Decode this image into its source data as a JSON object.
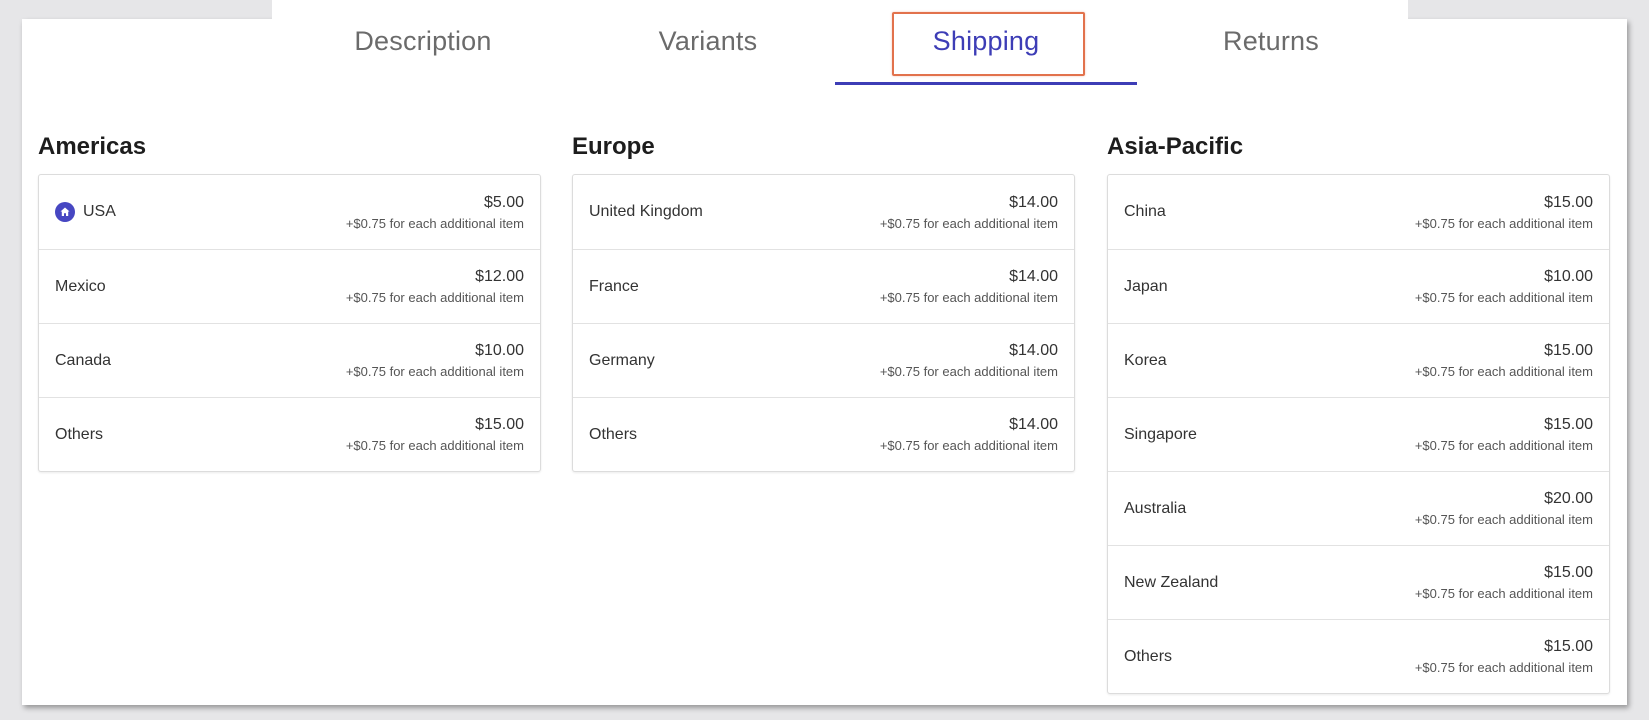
{
  "tabs": [
    {
      "label": "Description"
    },
    {
      "label": "Variants"
    },
    {
      "label": "Shipping"
    },
    {
      "label": "Returns"
    }
  ],
  "active_tab": "Shipping",
  "colors": {
    "accent": "#3d3db6",
    "highlight": "#e2724c"
  },
  "regions": [
    {
      "title": "Americas",
      "rows": [
        {
          "country": "USA",
          "price": "$5.00",
          "extra": "+$0.75 for each additional item",
          "icon": "home-icon"
        },
        {
          "country": "Mexico",
          "price": "$12.00",
          "extra": "+$0.75 for each additional item"
        },
        {
          "country": "Canada",
          "price": "$10.00",
          "extra": "+$0.75 for each additional item"
        },
        {
          "country": "Others",
          "price": "$15.00",
          "extra": "+$0.75 for each additional item"
        }
      ]
    },
    {
      "title": "Europe",
      "rows": [
        {
          "country": "United Kingdom",
          "price": "$14.00",
          "extra": "+$0.75 for each additional item"
        },
        {
          "country": "France",
          "price": "$14.00",
          "extra": "+$0.75 for each additional item"
        },
        {
          "country": "Germany",
          "price": "$14.00",
          "extra": "+$0.75 for each additional item"
        },
        {
          "country": "Others",
          "price": "$14.00",
          "extra": "+$0.75 for each additional item"
        }
      ]
    },
    {
      "title": "Asia-Pacific",
      "rows": [
        {
          "country": "China",
          "price": "$15.00",
          "extra": "+$0.75 for each additional item"
        },
        {
          "country": "Japan",
          "price": "$10.00",
          "extra": "+$0.75 for each additional item"
        },
        {
          "country": "Korea",
          "price": "$15.00",
          "extra": "+$0.75 for each additional item"
        },
        {
          "country": "Singapore",
          "price": "$15.00",
          "extra": "+$0.75 for each additional item"
        },
        {
          "country": "Australia",
          "price": "$20.00",
          "extra": "+$0.75 for each additional item"
        },
        {
          "country": "New Zealand",
          "price": "$15.00",
          "extra": "+$0.75 for each additional item"
        },
        {
          "country": "Others",
          "price": "$15.00",
          "extra": "+$0.75 for each additional item"
        }
      ]
    }
  ]
}
